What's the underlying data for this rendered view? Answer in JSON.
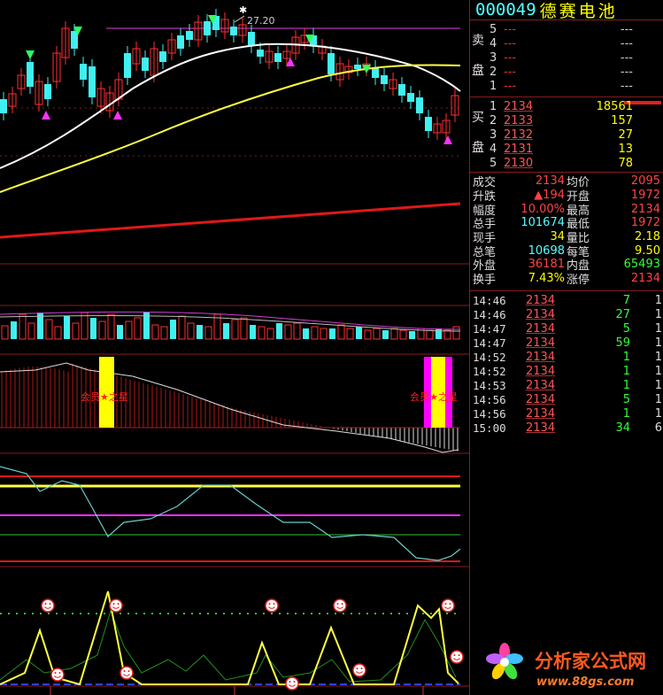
{
  "stock": {
    "code": "000049",
    "name": "德赛电池"
  },
  "chart_annotations": {
    "high_price_label": "27.20",
    "member_star_label": "会员★之星"
  },
  "order_book": {
    "sell_label": [
      "卖",
      "盘"
    ],
    "buy_label": [
      "买",
      "盘"
    ],
    "asks": [
      {
        "level": "5",
        "price": "---",
        "volume": "---"
      },
      {
        "level": "4",
        "price": "---",
        "volume": "---"
      },
      {
        "level": "3",
        "price": "---",
        "volume": "---"
      },
      {
        "level": "2",
        "price": "---",
        "volume": "---"
      },
      {
        "level": "1",
        "price": "---",
        "volume": "---"
      }
    ],
    "bids": [
      {
        "level": "1",
        "price": "2134",
        "volume": "18561"
      },
      {
        "level": "2",
        "price": "2133",
        "volume": "157"
      },
      {
        "level": "3",
        "price": "2132",
        "volume": "27"
      },
      {
        "level": "4",
        "price": "2131",
        "volume": "13"
      },
      {
        "level": "5",
        "price": "2130",
        "volume": "78"
      }
    ]
  },
  "stats": [
    {
      "l1": "成交",
      "v1": "2134",
      "c1": "red",
      "l2": "均价",
      "v2": "2095",
      "c2": "red"
    },
    {
      "l1": "升跌",
      "v1": "▲194",
      "c1": "red",
      "l2": "开盘",
      "v2": "1972",
      "c2": "red"
    },
    {
      "l1": "幅度",
      "v1": "10.00%",
      "c1": "red",
      "l2": "最高",
      "v2": "2134",
      "c2": "red"
    },
    {
      "l1": "总手",
      "v1": "101674",
      "c1": "cyan",
      "l2": "最低",
      "v2": "1972",
      "c2": "red"
    },
    {
      "l1": "现手",
      "v1": "34",
      "c1": "yel",
      "l2": "量比",
      "v2": "2.18",
      "c2": "yel"
    },
    {
      "l1": "总笔",
      "v1": "10698",
      "c1": "cyan",
      "l2": "每笔",
      "v2": "9.50",
      "c2": "yel"
    },
    {
      "l1": "外盘",
      "v1": "36181",
      "c1": "red",
      "l2": "内盘",
      "v2": "65493",
      "c2": "grn"
    },
    {
      "l1": "换手",
      "v1": "7.43%",
      "c1": "yel",
      "l2": "涨停",
      "v2": "2134",
      "c2": "red"
    }
  ],
  "ticks": [
    {
      "time": "14:46",
      "price": "2134",
      "vol": "7",
      "num": "1"
    },
    {
      "time": "14:46",
      "price": "2134",
      "vol": "27",
      "num": "1"
    },
    {
      "time": "14:47",
      "price": "2134",
      "vol": "5",
      "num": "1"
    },
    {
      "time": "14:47",
      "price": "2134",
      "vol": "59",
      "num": "1"
    },
    {
      "time": "14:52",
      "price": "2134",
      "vol": "1",
      "num": "1"
    },
    {
      "time": "14:52",
      "price": "2134",
      "vol": "1",
      "num": "1"
    },
    {
      "time": "14:53",
      "price": "2134",
      "vol": "1",
      "num": "1"
    },
    {
      "time": "14:56",
      "price": "2134",
      "vol": "5",
      "num": "1"
    },
    {
      "time": "14:56",
      "price": "2134",
      "vol": "1",
      "num": "1"
    },
    {
      "time": "15:00",
      "price": "2134",
      "vol": "34",
      "num": "6"
    }
  ],
  "colors": {
    "up": "#ff3030",
    "down": "#40f0f0",
    "ma_white": "#ffffff",
    "ma_yellow": "#ffff40",
    "ma_red": "#e01818",
    "grid": "#8a1a1a"
  },
  "watermark": {
    "title": "分析家公式网",
    "url": "www.88gs.com"
  }
}
